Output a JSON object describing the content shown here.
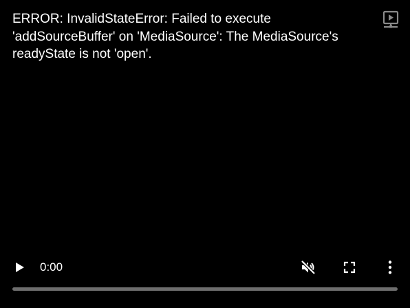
{
  "player": {
    "error_message": "ERROR: InvalidStateError: Failed to execute\n'addSourceBuffer' on 'MediaSource': The MediaSource's\nreadyState is not 'open'.",
    "current_time": "0:00",
    "progress_fraction": 0,
    "icons": {
      "cast": "cast-icon",
      "play": "play-icon",
      "mute": "muted-volume-icon",
      "fullscreen": "fullscreen-icon",
      "more": "more-vertical-icon"
    }
  },
  "colors": {
    "background": "#000000",
    "text": "#ffffff",
    "icon": "#ffffff",
    "cast_icon": "#8a8a8a",
    "progress_track": "#6e6e6e",
    "progress_fill": "#ffffff"
  }
}
